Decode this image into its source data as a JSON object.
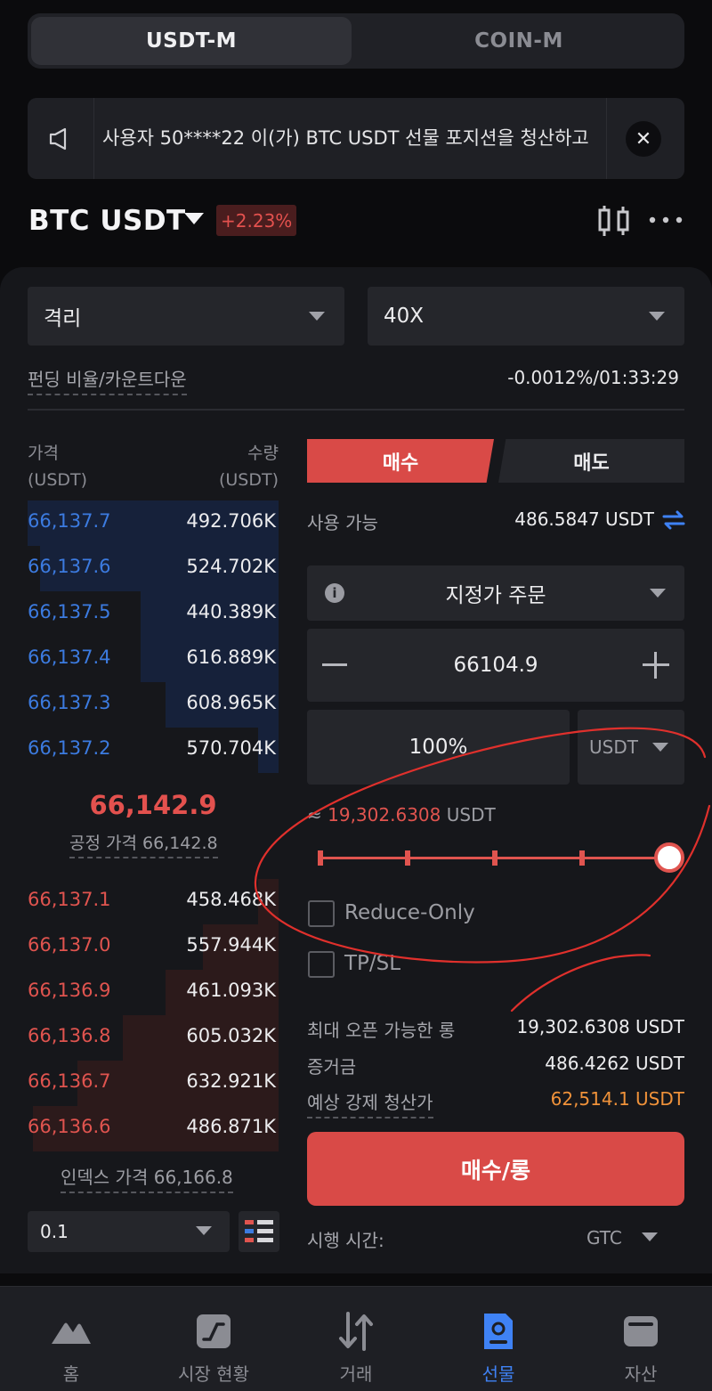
{
  "mode_tabs": {
    "active": "USDT-M",
    "inactive": "COIN-M"
  },
  "notice": {
    "text": "사용자 50****22 이(가) BTC USDT 선물 포지션을 청산하고"
  },
  "symbol": {
    "name": "BTC USDT",
    "change": "+2.23%"
  },
  "margin": {
    "mode": "격리",
    "leverage": "40X"
  },
  "funding": {
    "label": "펀딩 비율/카운트다운",
    "value": "-0.0012%/01:33:29"
  },
  "orderbook": {
    "price_header": "가격",
    "price_unit": "(USDT)",
    "qty_header": "수량",
    "qty_unit": "(USDT)",
    "asks": [
      {
        "price": "66,137.7",
        "qty": "492.706K",
        "depth": 1.0
      },
      {
        "price": "66,137.6",
        "qty": "524.702K",
        "depth": 0.95
      },
      {
        "price": "66,137.5",
        "qty": "440.389K",
        "depth": 0.55
      },
      {
        "price": "66,137.4",
        "qty": "616.889K",
        "depth": 0.55
      },
      {
        "price": "66,137.3",
        "qty": "608.965K",
        "depth": 0.45
      },
      {
        "price": "66,137.2",
        "qty": "570.704K",
        "depth": 0.08
      }
    ],
    "mid_price": "66,142.9",
    "fair_price": "공정 가격 66,142.8",
    "bids": [
      {
        "price": "66,137.1",
        "qty": "458.468K",
        "depth": 0.08
      },
      {
        "price": "66,137.0",
        "qty": "557.944K",
        "depth": 0.3
      },
      {
        "price": "66,136.9",
        "qty": "461.093K",
        "depth": 0.45
      },
      {
        "price": "66,136.8",
        "qty": "605.032K",
        "depth": 0.62
      },
      {
        "price": "66,136.7",
        "qty": "632.921K",
        "depth": 0.8
      },
      {
        "price": "66,136.6",
        "qty": "486.871K",
        "depth": 0.98
      }
    ],
    "index_price": "인덱스 가격 66,166.8",
    "tick_size": "0.1"
  },
  "trade": {
    "buy_tab": "매수",
    "sell_tab": "매도",
    "available_label": "사용 가능",
    "available_value": "486.5847 USDT",
    "order_type": "지정가 주문",
    "price": "66104.9",
    "percent": "100%",
    "unit": "USDT",
    "approx_prefix": "≈",
    "approx_value": "19,302.6308",
    "approx_unit": "USDT",
    "slider_level": 1.0,
    "reduce_only": "Reduce-Only",
    "tpsl": "TP/SL",
    "max_open_label": "최대 오픈 가능한 롱",
    "max_open_value": "19,302.6308 USDT",
    "margin_label": "증거금",
    "margin_value": "486.4262 USDT",
    "liq_label": "예상 강제 청산가",
    "liq_value": "62,514.1 USDT",
    "submit": "매수/롱",
    "tif_label": "시행 시간:",
    "tif_value": "GTC"
  },
  "colors": {
    "buy": "#d94a47",
    "ask": "#3c7be0",
    "liq": "#f0923a",
    "accent": "#3f82f5"
  },
  "nav": [
    {
      "label": "홈",
      "icon": "home-mountain-icon"
    },
    {
      "label": "시장 현황",
      "icon": "market-chart-icon"
    },
    {
      "label": "거래",
      "icon": "trade-arrows-icon"
    },
    {
      "label": "선물",
      "icon": "futures-doc-icon",
      "active": true
    },
    {
      "label": "자산",
      "icon": "wallet-icon"
    }
  ]
}
